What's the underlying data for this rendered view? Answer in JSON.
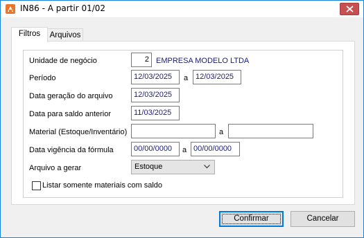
{
  "window": {
    "title": "IN86 - A partir 01/02"
  },
  "tabs": [
    {
      "label": "Filtros"
    },
    {
      "label": "Arquivos"
    }
  ],
  "form": {
    "unidade_label": "Unidade de negócio",
    "unidade_value": "2",
    "unidade_name": "EMPRESA MODELO LTDA",
    "periodo_label": "Período",
    "periodo_from": "12/03/2025",
    "periodo_sep": "a",
    "periodo_to": "12/03/2025",
    "data_geracao_label": "Data geração do arquivo",
    "data_geracao_value": "12/03/2025",
    "data_saldo_label": "Data para saldo anterior",
    "data_saldo_value": "11/03/2025",
    "material_label": "Material (Estoque/Inventário)",
    "material_from": "",
    "material_sep": "a",
    "material_to": "",
    "vigencia_label": "Data vigência da fórmula",
    "vigencia_from": "00/00/0000",
    "vigencia_sep": "a",
    "vigencia_to": "00/00/0000",
    "arquivo_label": "Arquivo a gerar",
    "arquivo_selected": "Estoque",
    "listar_label": "Listar somente materiais com saldo",
    "listar_checked": false
  },
  "buttons": {
    "confirm": "Confirmar",
    "cancel": "Cancelar"
  },
  "colors": {
    "window_border": "#1883d7",
    "close_button": "#c75050",
    "field_text": "#1c1c6e"
  }
}
